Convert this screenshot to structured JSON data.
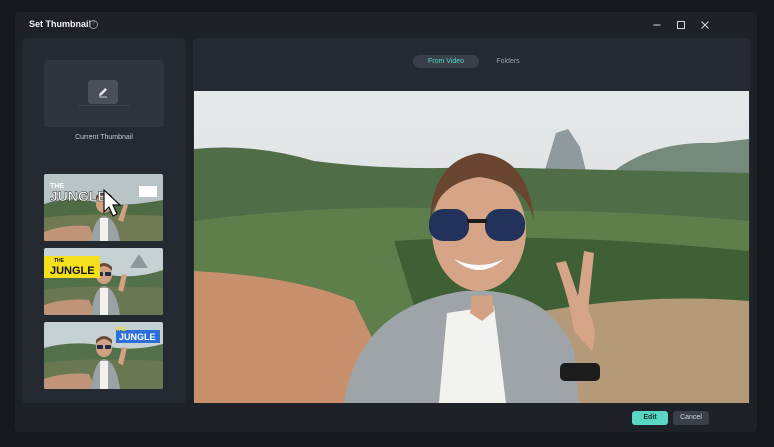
{
  "window": {
    "title": "Set Thumbnail",
    "controls": [
      "minimize-icon",
      "maximize-icon",
      "close-icon"
    ]
  },
  "left_panel": {
    "current_thumbnail_label": "Current Thumbnail",
    "thumbnails": [
      {
        "text": "JUNGLE",
        "style": "white-title-with-cursor"
      },
      {
        "text": "JUNGLE",
        "style": "yellow-banner"
      },
      {
        "text": "JUNGLE",
        "style": "blue-banner"
      }
    ]
  },
  "tabs": [
    {
      "label": "From Video",
      "active": true
    },
    {
      "label": "Folders",
      "active": false
    }
  ],
  "footer": {
    "edit_label": "Edit",
    "cancel_label": "Cancel"
  },
  "colors": {
    "accent": "#59d7c4",
    "window_bg": "#1e2128",
    "panel_bg": "#252932"
  }
}
